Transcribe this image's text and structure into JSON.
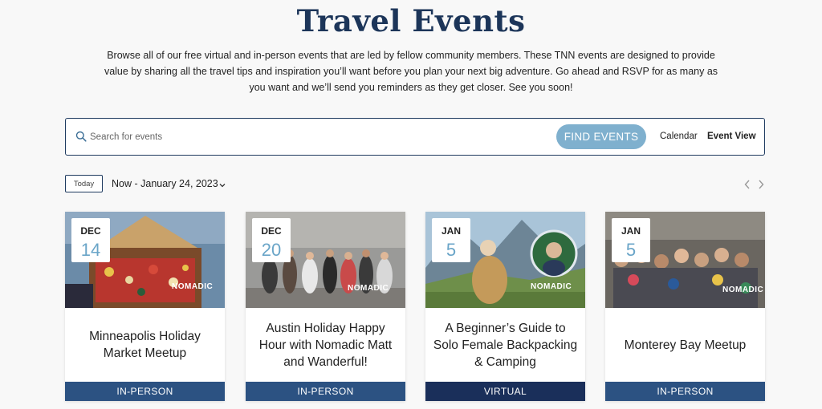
{
  "page": {
    "title": "Travel Events",
    "intro": "Browse all of our free virtual and in-person events that are led by fellow community members. These TNN events are designed to provide value by sharing all the travel tips and inspiration you’ll want before you plan your next big adventure. Go ahead and RSVP for as many as you want and we’ll send you reminders as they get closer. See you soon!"
  },
  "search": {
    "placeholder": "Search for events",
    "find_label": "FIND EVENTS",
    "views": [
      "Calendar",
      "Event View"
    ],
    "active_view": "Event View",
    "icon": "search-icon"
  },
  "date_nav": {
    "today_label": "Today",
    "range_label": "Now - January 24, 2023",
    "icons": [
      "chevron-down-icon",
      "chevron-left-icon",
      "chevron-right-icon"
    ]
  },
  "events": [
    {
      "month": "DEC",
      "day": "14",
      "title": "Minneapolis Holiday Market Meetup",
      "type": "IN-PERSON",
      "logo": "NOMADIC"
    },
    {
      "month": "DEC",
      "day": "20",
      "title": "Austin Holiday Happy Hour with Nomadic Matt and Wanderful!",
      "type": "IN-PERSON",
      "logo": "NOMADIC"
    },
    {
      "month": "JAN",
      "day": "5",
      "title": "A Beginner’s Guide to Solo Female Backpacking & Camping",
      "type": "VIRTUAL",
      "logo": "NOMADIC"
    },
    {
      "month": "JAN",
      "day": "5",
      "title": "Monterey Bay Meetup",
      "type": "IN-PERSON",
      "logo": "NOMADIC"
    }
  ],
  "colors": {
    "title": "#1c3559",
    "accent_button": "#7fb0ce",
    "badge_in_person": "#2c5282",
    "badge_virtual": "#1a2f5a",
    "date_day": "#6aa5c8"
  }
}
